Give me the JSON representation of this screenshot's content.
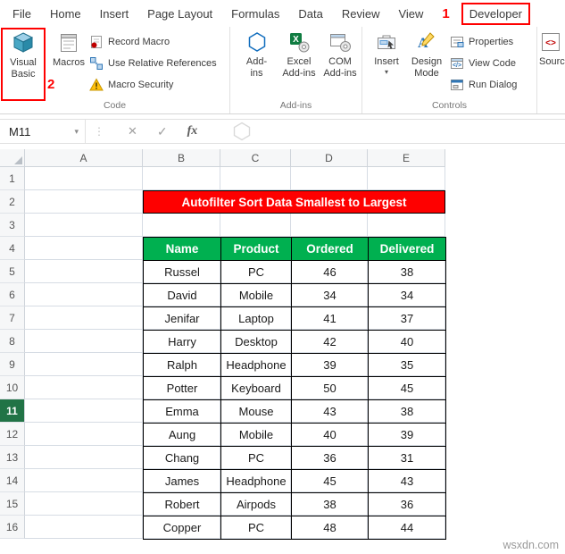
{
  "ribbon": {
    "tabs": [
      "File",
      "Home",
      "Insert",
      "Page Layout",
      "Formulas",
      "Data",
      "Review",
      "View",
      "Developer"
    ],
    "active_tab": "Developer",
    "annotations": {
      "one": "1",
      "two": "2"
    },
    "code_group": {
      "label": "Code",
      "visual_basic": "Visual Basic",
      "macros": "Macros",
      "record_macro": "Record Macro",
      "use_relative_references": "Use Relative References",
      "macro_security": "Macro Security"
    },
    "addins_group": {
      "label": "Add-ins",
      "addins": "Add-ins",
      "excel_addins": "Excel Add-ins",
      "com_addins": "COM Add-ins"
    },
    "controls_group": {
      "label": "Controls",
      "insert": "Insert",
      "design_mode": "Design Mode",
      "properties": "Properties",
      "view_code": "View Code",
      "run_dialog": "Run Dialog"
    },
    "source_group": {
      "source": "Source"
    }
  },
  "formula_bar": {
    "name_box": "M11",
    "fx_label": "fx"
  },
  "sheet": {
    "columns": [
      "A",
      "B",
      "C",
      "D",
      "E"
    ],
    "row_count": 16,
    "selected_row": "11",
    "banner": {
      "text": "Autofilter Sort Data Smallest to Largest",
      "bg": "#FE0000",
      "fg": "#FFFFFF"
    },
    "table": {
      "header_bg": "#00B050",
      "headers": [
        "Name",
        "Product",
        "Ordered",
        "Delivered"
      ],
      "rows": [
        [
          "Russel",
          "PC",
          "46",
          "38"
        ],
        [
          "David",
          "Mobile",
          "34",
          "34"
        ],
        [
          "Jenifar",
          "Laptop",
          "41",
          "37"
        ],
        [
          "Harry",
          "Desktop",
          "42",
          "40"
        ],
        [
          "Ralph",
          "Headphone",
          "39",
          "35"
        ],
        [
          "Potter",
          "Keyboard",
          "50",
          "45"
        ],
        [
          "Emma",
          "Mouse",
          "43",
          "38"
        ],
        [
          "Aung",
          "Mobile",
          "40",
          "39"
        ],
        [
          "Chang",
          "PC",
          "36",
          "31"
        ],
        [
          "James",
          "Headphone",
          "45",
          "43"
        ],
        [
          "Robert",
          "Airpods",
          "38",
          "36"
        ],
        [
          "Copper",
          "PC",
          "48",
          "44"
        ]
      ]
    }
  },
  "colors": {
    "accent_red": "#FF0000",
    "selected_row_bg": "#217346",
    "grid_line": "#D6DCE4"
  },
  "watermark": "wsxdn.com"
}
